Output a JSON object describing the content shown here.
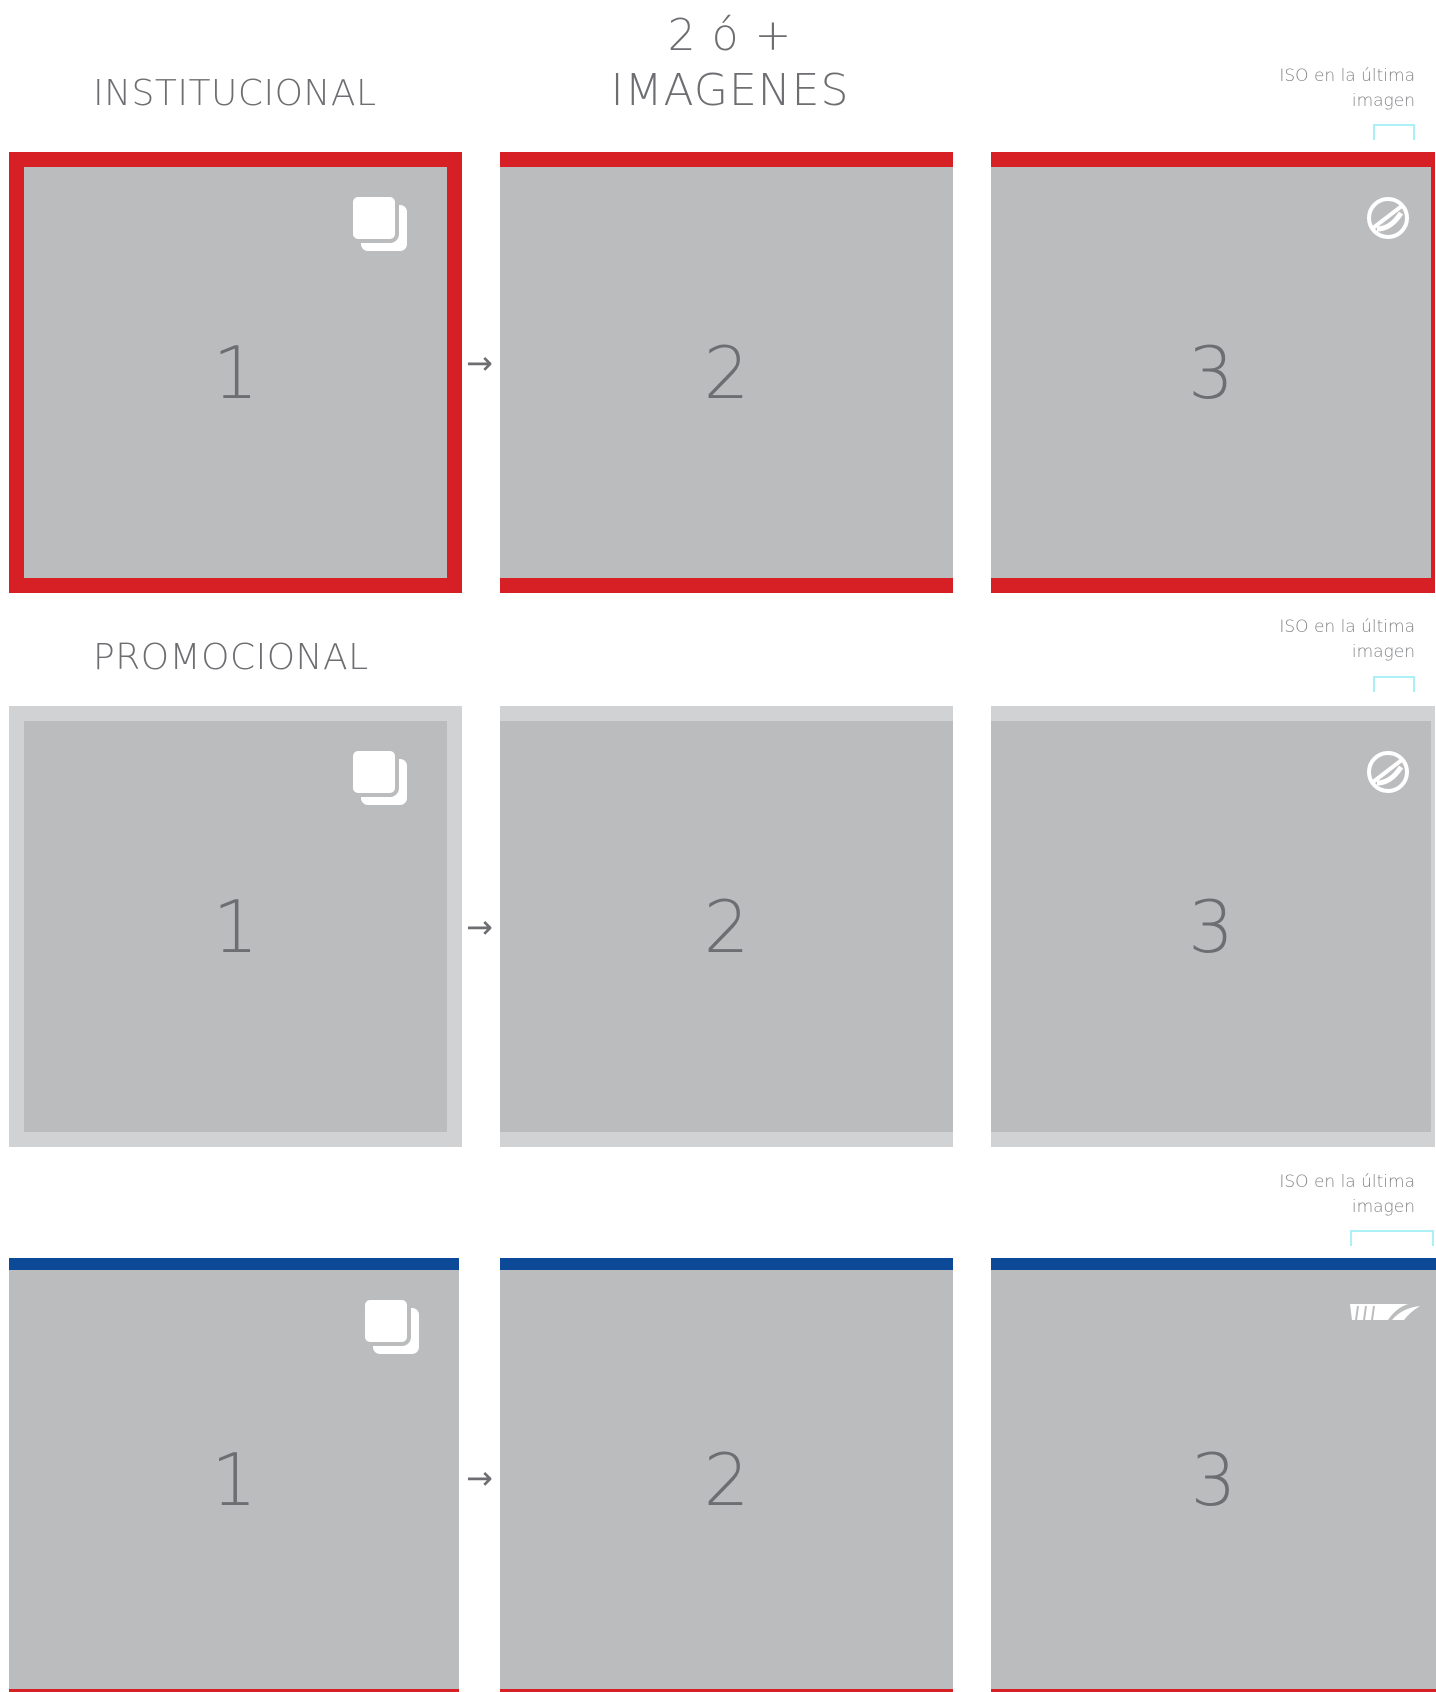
{
  "title": {
    "line1": "2 ó +",
    "line2": "IMAGENES"
  },
  "sections": [
    {
      "name": "INSTITUCIONAL",
      "iso_note_line1": "ISO en la última",
      "iso_note_line2": "imagen",
      "panels": [
        "1",
        "2",
        "3"
      ],
      "frame_color": "#d71f26"
    },
    {
      "name": "PROMOCIONAL",
      "iso_note_line1": "ISO en la última",
      "iso_note_line2": "imagen",
      "panels": [
        "1",
        "2",
        "3"
      ],
      "frame_color": "#d1d2d4"
    },
    {
      "name": "",
      "iso_note_line1": "ISO en la última",
      "iso_note_line2": "imagen",
      "panels": [
        "1",
        "2",
        "3"
      ],
      "frame_color": "#0c4a97"
    }
  ],
  "arrow_glyph": "→",
  "icons": {
    "first_panel": "layers-icon",
    "last_panel_rows_1_2": "iso-logo-icon",
    "last_panel_row_3": "brand-stripes-icon"
  },
  "colors": {
    "red": "#d71f26",
    "blue": "#0c4a97",
    "panel_grey": "#bbbcbe",
    "light_grey_frame": "#d1d2d4",
    "cyan_bracket": "#aaf0f5"
  }
}
